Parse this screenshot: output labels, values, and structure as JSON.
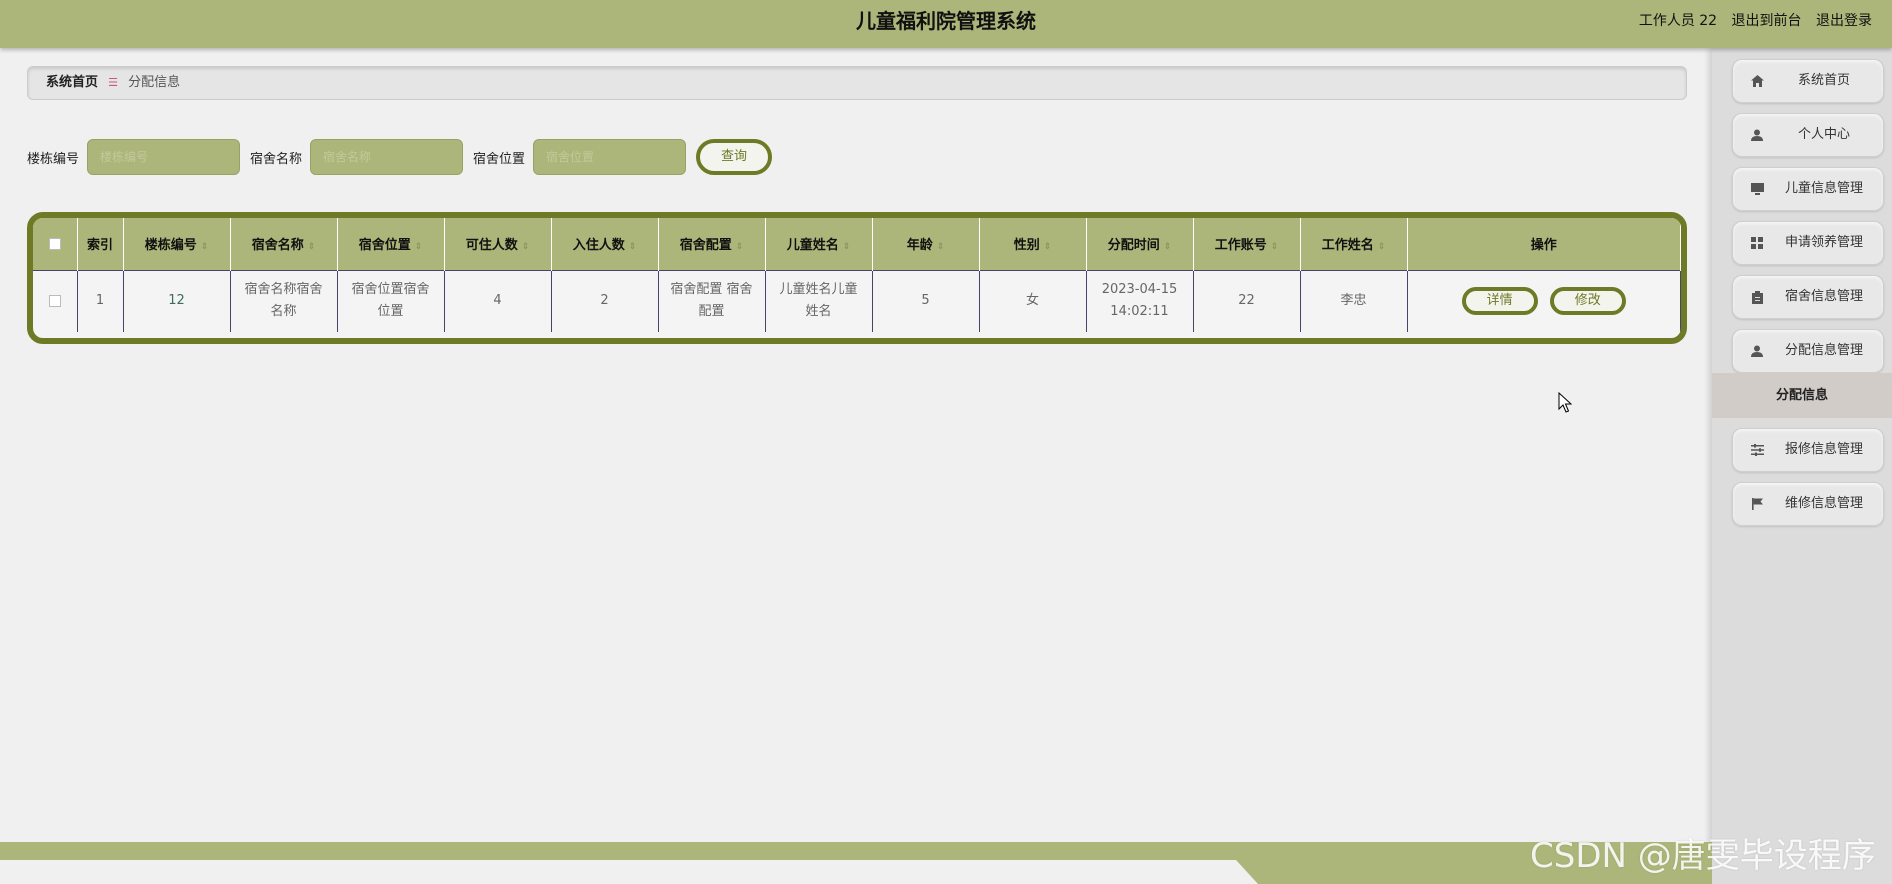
{
  "header": {
    "title": "儿童福利院管理系统",
    "user_label": "工作人员 22",
    "back_label": "退出到前台",
    "logout_label": "退出登录"
  },
  "breadcrumb": {
    "home": "系统首页",
    "separator": "☰",
    "current": "分配信息"
  },
  "search": {
    "fields": [
      {
        "label": "楼栋编号",
        "placeholder": "楼栋编号"
      },
      {
        "label": "宿舍名称",
        "placeholder": "宿舍名称"
      },
      {
        "label": "宿舍位置",
        "placeholder": "宿舍位置"
      }
    ],
    "query_label": "查询"
  },
  "table": {
    "headers": [
      "索引",
      "楼栋编号",
      "宿舍名称",
      "宿舍位置",
      "可住人数",
      "入住人数",
      "宿舍配置",
      "儿童姓名",
      "年龄",
      "性别",
      "分配时间",
      "工作账号",
      "工作姓名",
      "操作"
    ],
    "rows": [
      {
        "index": "1",
        "building_no": "12",
        "dorm_name": "宿舍名称宿舍名称",
        "dorm_location": "宿舍位置宿舍位置",
        "capacity": "4",
        "occupied": "2",
        "dorm_config": "宿舍配置 宿舍配置",
        "child_name": "儿童姓名儿童姓名",
        "age": "5",
        "gender": "女",
        "assign_time": "2023-04-15 14:02:11",
        "staff_account": "22",
        "staff_name": "李忠",
        "detail_label": "详情",
        "edit_label": "修改"
      }
    ]
  },
  "sidebar": {
    "items": [
      {
        "label": "系统首页",
        "icon": "home-icon"
      },
      {
        "label": "个人中心",
        "icon": "user-icon"
      },
      {
        "label": "儿童信息管理",
        "icon": "monitor-icon"
      },
      {
        "label": "申请领养管理",
        "icon": "grid-icon"
      },
      {
        "label": "宿舍信息管理",
        "icon": "clipboard-icon"
      },
      {
        "label": "分配信息管理",
        "icon": "user-icon"
      },
      {
        "label": "报修信息管理",
        "icon": "sliders-icon"
      },
      {
        "label": "维修信息管理",
        "icon": "flag-icon"
      }
    ],
    "active_sub": "分配信息"
  },
  "watermark": "CSDN @唐雯毕设程序",
  "colors": {
    "brand": "#adb67a",
    "accent": "#6e7a25",
    "background": "#f0f0f0"
  }
}
